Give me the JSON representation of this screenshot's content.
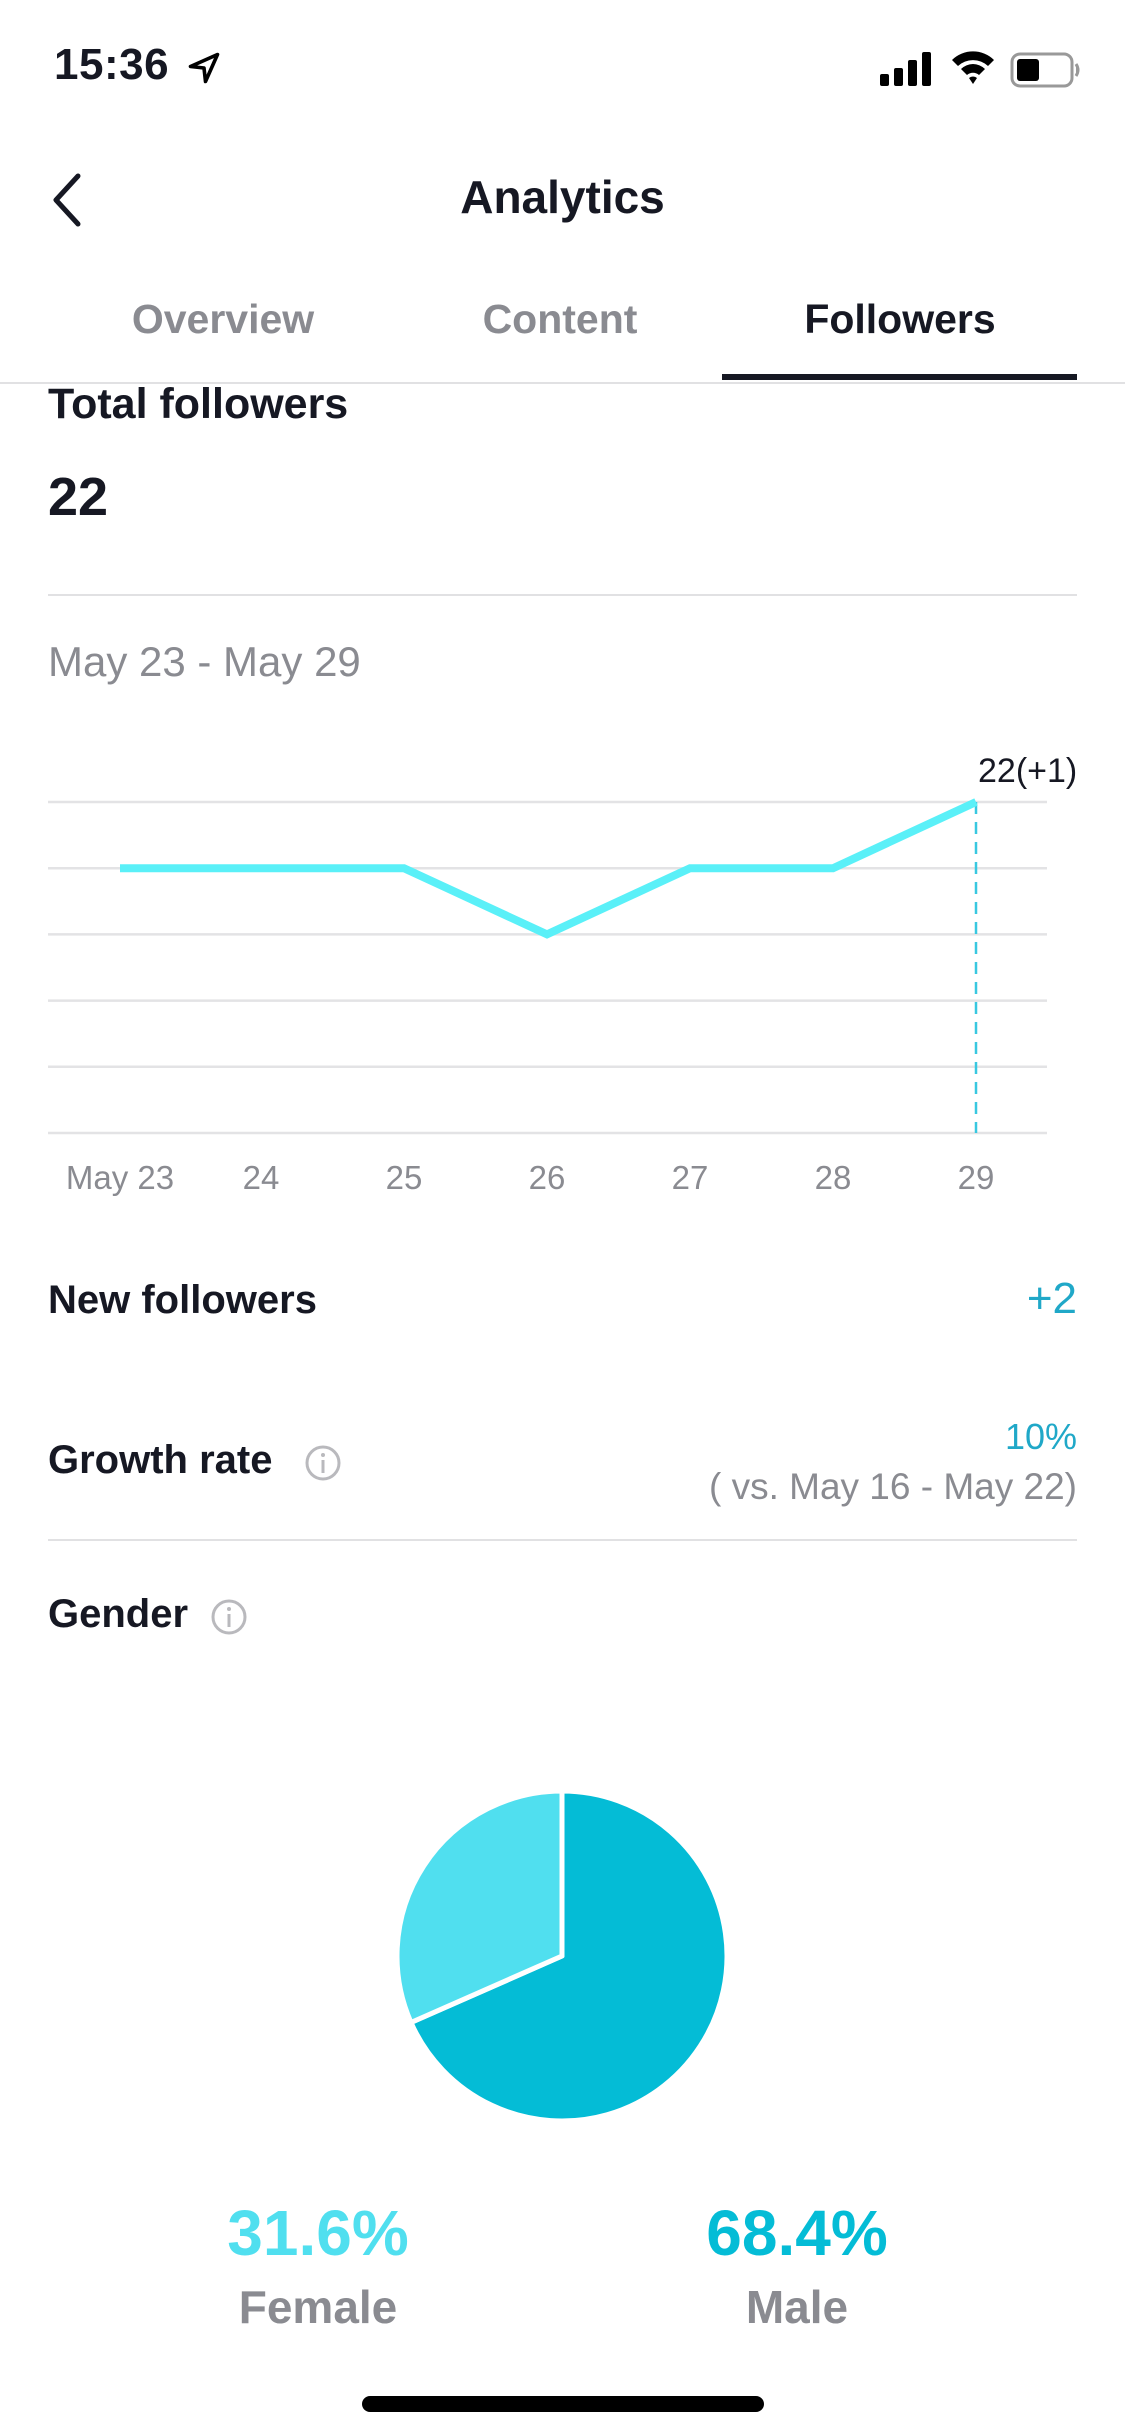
{
  "status_bar": {
    "time": "15:36",
    "icons": [
      "location-arrow-icon",
      "cellular-signal-icon",
      "wifi-icon",
      "battery-icon"
    ]
  },
  "header": {
    "title": "Analytics",
    "back_icon": "chevron-left-icon"
  },
  "tabs": [
    {
      "label": "Overview",
      "active": false
    },
    {
      "label": "Content",
      "active": false
    },
    {
      "label": "Followers",
      "active": true
    }
  ],
  "total_followers": {
    "label": "Total followers",
    "value": "22"
  },
  "date_range": "May 23 - May 29",
  "chart_data": {
    "type": "line",
    "title": "",
    "xlabel": "",
    "ylabel": "",
    "categories": [
      "May 23",
      "24",
      "25",
      "26",
      "27",
      "28",
      "29"
    ],
    "series": [
      {
        "name": "Followers",
        "values": [
          21,
          21,
          21,
          20,
          21,
          21,
          22
        ]
      }
    ],
    "ylim": [
      17,
      22
    ],
    "grid": true,
    "gridlines": 6,
    "highlight": {
      "index": 6,
      "label": "22(+1)"
    },
    "line_color": "#5af0f8",
    "guide_color": "#38c8e0"
  },
  "new_followers": {
    "label": "New followers",
    "value": "+2"
  },
  "growth_rate": {
    "label": "Growth rate",
    "value": "10%",
    "comparison": "( vs. May 16 - May 22)"
  },
  "gender": {
    "label": "Gender",
    "chart_data": {
      "type": "pie",
      "slices": [
        {
          "name": "Female",
          "value": 31.6,
          "label": "31.6%",
          "color": "#50dfef"
        },
        {
          "name": "Male",
          "value": 68.4,
          "label": "68.4%",
          "color": "#04bcd6"
        }
      ]
    }
  },
  "colors": {
    "accent": "#20a8c8",
    "text_primary": "#161823",
    "text_secondary": "#8a8b91"
  }
}
